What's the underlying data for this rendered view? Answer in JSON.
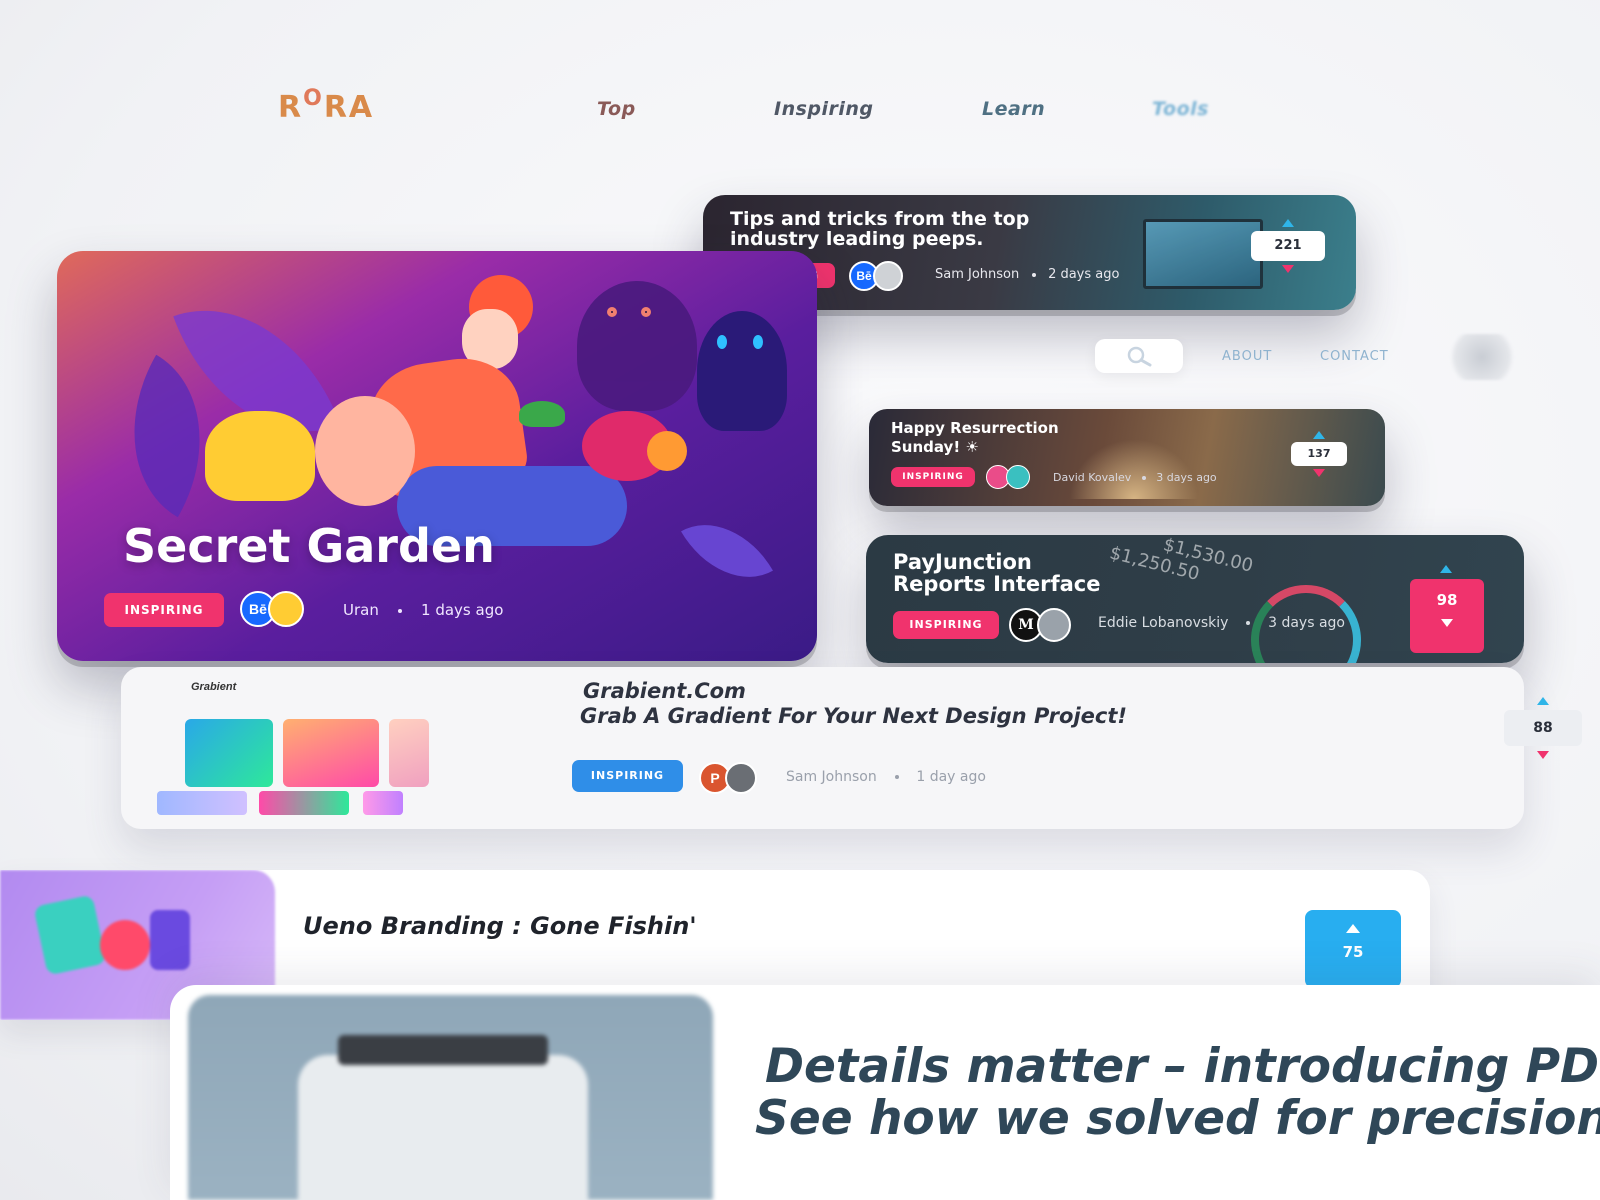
{
  "brand": {
    "logo": "RORA"
  },
  "nav": {
    "top": "Top",
    "inspiring": "Inspiring",
    "learn": "Learn",
    "tools": "Tools"
  },
  "subnav": {
    "about": "ABOUT",
    "contact": "CONTACT"
  },
  "cards": {
    "tips": {
      "title_line1": "Tips and tricks from the top",
      "title_line2": "industry leading peeps.",
      "tag": "INSPIRING",
      "avatar1": "Bē",
      "author": "Sam Johnson",
      "time": "2 days ago",
      "votes": "221"
    },
    "garden": {
      "title": "Secret Garden",
      "tag": "INSPIRING",
      "avatar1": "Bē",
      "author": "Uran",
      "time": "1 days ago"
    },
    "happy": {
      "title_line1": "Happy Resurrection",
      "title_line2": "Sunday! ☀",
      "tag": "INSPIRING",
      "author": "David Kovalev",
      "time": "3 days ago",
      "votes": "137"
    },
    "pay": {
      "title_line1": "PayJunction",
      "title_line2": "Reports Interface",
      "tag": "INSPIRING",
      "avatar1": "M",
      "author": "Eddie Lobanovskiy",
      "time": "3 days ago",
      "votes": "98",
      "figure1": "$1,530.00",
      "figure2": "$1,250.50"
    },
    "grab": {
      "thumb_label": "Grabient",
      "title_line1": "Grabient.Com",
      "title_line2": "Grab A Gradient For Your Next Design Project!",
      "tag": "INSPIRING",
      "avatar1": "P",
      "author": "Sam Johnson",
      "time": "1 day ago",
      "votes": "88"
    },
    "ueno": {
      "title": "Ueno Branding : Gone Fishin'",
      "votes": "75"
    },
    "details": {
      "line1": "Details matter – introducing PD",
      "line2": "See how we solved for precision"
    }
  },
  "icons": {
    "search": "search-icon",
    "up": "triangle-up-icon",
    "down": "triangle-down-icon",
    "behance": "behance-icon",
    "dribbble": "dribbble-icon",
    "medium": "medium-icon",
    "producthunt": "producthunt-icon"
  },
  "colors": {
    "tag_pink": "#f0336d",
    "tag_blue": "#2f8ee8",
    "vote_blue": "#28aef0",
    "logo": "#d98a4a"
  }
}
